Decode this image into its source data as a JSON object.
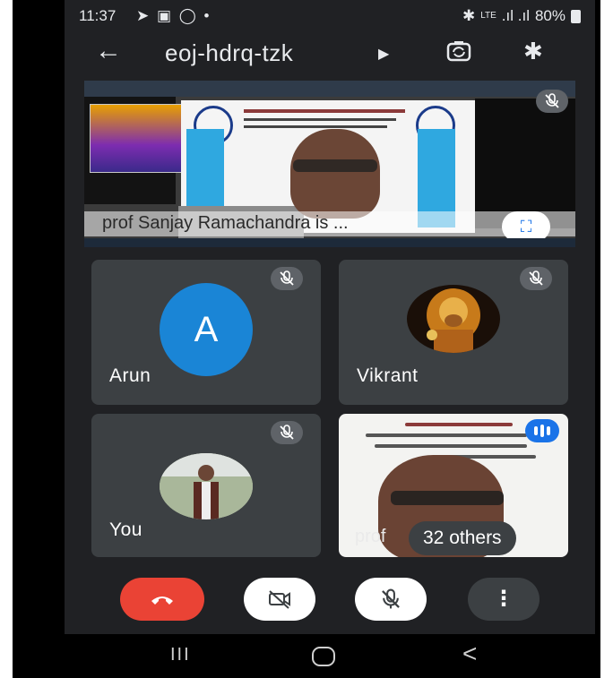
{
  "status_bar": {
    "time": "11:37",
    "network_label": "Vo)) LTE\nLTE1 ↓↑",
    "network_text": "LTE",
    "battery": "80%"
  },
  "top_bar": {
    "meeting_code": "eoj-hdrq-tzk"
  },
  "presentation": {
    "caption": "prof Sanjay Ramachandra is ..."
  },
  "participants": [
    {
      "name": "Arun",
      "avatar_letter": "A",
      "avatar_color": "#1a85d6",
      "muted": true
    },
    {
      "name": "Vikrant",
      "muted": true
    },
    {
      "name": "You",
      "muted": true
    },
    {
      "name": "prof",
      "others_label": "32 others"
    }
  ],
  "controls": {
    "end_color": "#ea4335",
    "more_label": "⋮"
  },
  "nav": {
    "recents": "III",
    "back": "<"
  }
}
